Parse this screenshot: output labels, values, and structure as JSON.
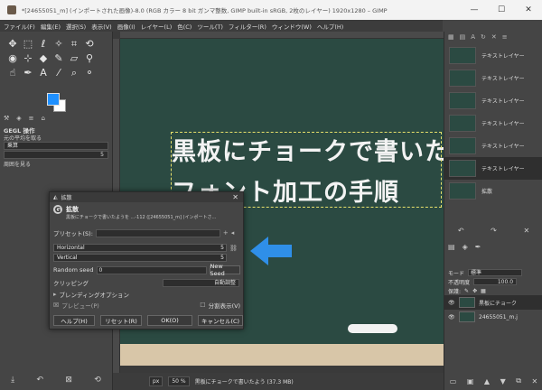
{
  "window": {
    "title": "*[24655051_m] (インポートされた画像)-8.0 (RGB カラー 8 bit ガンマ整数, GIMP built-in sRGB, 2枚のレイヤー) 1920x1280 – GIMP",
    "controls": {
      "minimize": "—",
      "maximize": "☐",
      "close": "✕"
    }
  },
  "menubar": [
    "ファイル(F)",
    "編集(E)",
    "選択(S)",
    "表示(V)",
    "画像(I)",
    "レイヤー(L)",
    "色(C)",
    "ツール(T)",
    "フィルター(R)",
    "ウィンドウ(W)",
    "ヘルプ(H)"
  ],
  "toolbox": {
    "tabs": [
      "⚒",
      "◈",
      "≡",
      "⌂"
    ],
    "panel_title": "GEGL 操作",
    "opt1": "元の平均を取る",
    "mode_label": "乗算",
    "mode_value": "5",
    "opt2": "周囲を見る"
  },
  "canvas": {
    "line1": "黒板にチョークで書いた",
    "line2": "フォント加工の手順"
  },
  "status": {
    "unit": "px",
    "zoom": "50 %",
    "text": "黒板にチョークで書いたよう (37.3 MB)"
  },
  "history": [
    {
      "label": "テキストレイヤー"
    },
    {
      "label": "テキストレイヤー"
    },
    {
      "label": "テキストレイヤー"
    },
    {
      "label": "テキストレイヤー"
    },
    {
      "label": "テキストレイヤー"
    },
    {
      "label": "テキストレイヤー"
    },
    {
      "label": "拡散"
    }
  ],
  "layers": {
    "mode_label": "モード",
    "mode_value": "標準",
    "opacity_label": "不透明度",
    "opacity_value": "100.0",
    "lock_label": "保護:",
    "items": [
      {
        "name": "黒板にチョーク"
      },
      {
        "name": "24655051_m.j"
      }
    ]
  },
  "dialog": {
    "title": "拡散",
    "heading": "拡散",
    "subheading": "黒板にチョークで書いたようを ...-112 ([24655051_m] (インポートさ...",
    "preset_label": "プリセット(S):",
    "horizontal_label": "Horizontal",
    "horizontal_value": "5",
    "vertical_label": "Vertical",
    "vertical_value": "5",
    "seed_label": "Random seed",
    "seed_value": "0",
    "new_seed": "New Seed",
    "clipping_label": "クリッピング",
    "clipping_value": "自動調整",
    "blending_label": "ブレンディングオプション",
    "preview_label": "プレビュー(P)",
    "split_label": "分割表示(V)",
    "help_button": "ヘルプ(H)",
    "reset_button": "リセット(R)",
    "ok_button": "OK(O)",
    "cancel_button": "キャンセル(C)"
  },
  "colors": {
    "accent_arrow": "#2f8fe8",
    "fg_color": "#1e90ff",
    "bg_color": "#ffffff",
    "chalkboard": "#2b4a42"
  }
}
